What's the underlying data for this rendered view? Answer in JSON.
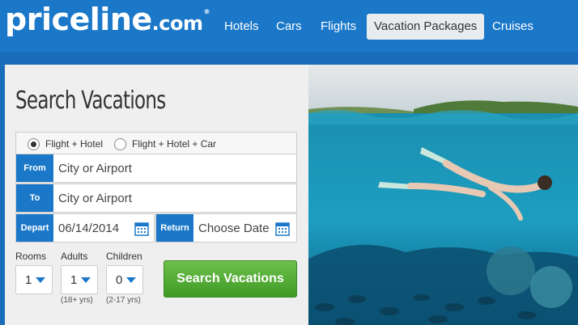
{
  "header": {
    "logo": {
      "main": "priceline",
      "suffix": ".com",
      "reg": "®"
    },
    "nav": [
      {
        "label": "Hotels"
      },
      {
        "label": "Cars"
      },
      {
        "label": "Flights"
      },
      {
        "label": "Vacation Packages",
        "active": true
      },
      {
        "label": "Cruises"
      }
    ]
  },
  "search": {
    "title": "Search Vacations",
    "options": [
      {
        "label": "Flight + Hotel",
        "selected": true
      },
      {
        "label": "Flight + Hotel + Car",
        "selected": false
      }
    ],
    "from": {
      "label": "From",
      "placeholder": "City or Airport"
    },
    "to": {
      "label": "To",
      "placeholder": "City or Airport"
    },
    "depart": {
      "label": "Depart",
      "value": "06/14/2014"
    },
    "return": {
      "label": "Return",
      "placeholder": "Choose Date"
    },
    "rooms": {
      "label": "Rooms",
      "value": "1"
    },
    "adults": {
      "label": "Adults",
      "value": "1",
      "hint": "(18+ yrs)"
    },
    "children": {
      "label": "Children",
      "value": "0",
      "hint": "(2-17 yrs)"
    },
    "button": "Search Vacations"
  },
  "icons": [
    "calendar-icon",
    "chevron-down-icon"
  ],
  "colors": {
    "brand_blue": "#1b78c9",
    "search_green": "#4caf33"
  }
}
